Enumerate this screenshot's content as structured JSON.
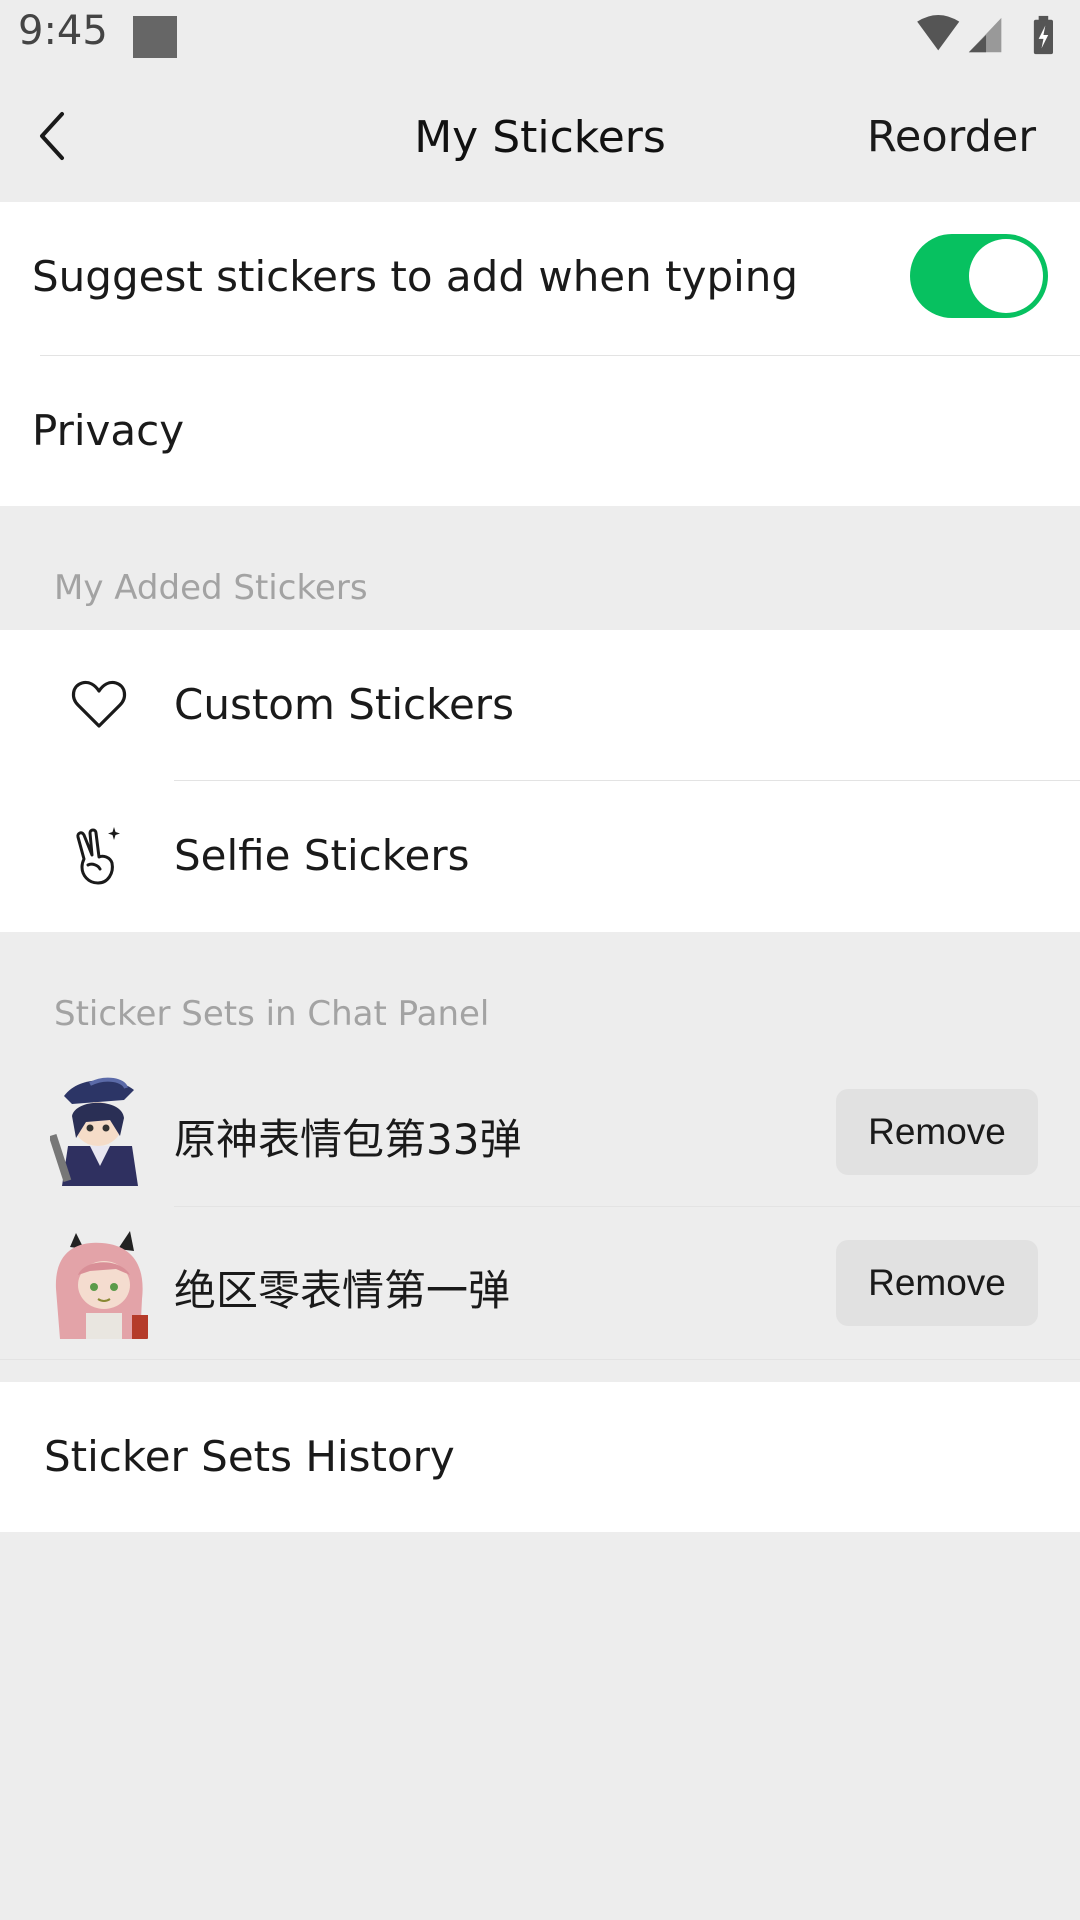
{
  "status_bar": {
    "time": "9:45",
    "icons": [
      "wifi-icon",
      "cellular-signal-icon",
      "battery-charging-icon"
    ]
  },
  "header": {
    "back_icon": "chevron-left-icon",
    "title": "My Stickers",
    "reorder_label": "Reorder"
  },
  "settings": {
    "suggest_label": "Suggest stickers to add when typing",
    "suggest_enabled": true,
    "privacy_label": "Privacy"
  },
  "added_section": {
    "label": "My Added Stickers",
    "items": [
      {
        "label": "Custom Stickers",
        "icon": "heart-icon"
      },
      {
        "label": "Selfie Stickers",
        "icon": "victory-hand-icon"
      }
    ]
  },
  "panel_section": {
    "label": "Sticker Sets in Chat Panel",
    "items": [
      {
        "name": "原神表情包第33弹",
        "button_label": "Remove",
        "thumb": "sticker-thumbnail-genshin"
      },
      {
        "name": "绝区零表情第一弹",
        "button_label": "Remove",
        "thumb": "sticker-thumbnail-zzz"
      }
    ]
  },
  "history": {
    "label": "Sticker Sets History"
  },
  "colors": {
    "accent_green": "#07c160",
    "background": "#ededed",
    "card": "#ffffff",
    "secondary_text": "#a3a3a3"
  }
}
